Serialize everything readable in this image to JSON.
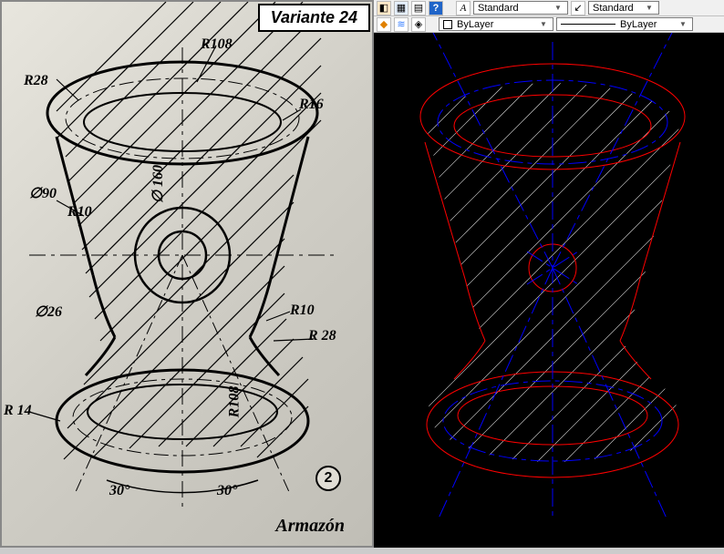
{
  "left": {
    "variant": "Variante 24",
    "footer": "Armazón",
    "badge": "2",
    "dims": {
      "R108_top": "R108",
      "R28_top": "R28",
      "R16": "R16",
      "phi90": "∅90",
      "R10_left": "R10",
      "phi160": "∅ 160",
      "phi26": "∅26",
      "R10_right": "R10",
      "R28_right": "R 28",
      "R14": "R 14",
      "R108_bottom": "R108",
      "ang_left": "30°",
      "ang_right": "30°"
    }
  },
  "toolbar": {
    "combo1": "Standard",
    "combo2": "Standard",
    "combo3": "ByLayer",
    "combo4": "ByLayer"
  },
  "chart_data": {
    "type": "technical-drawing",
    "title": "Armazón — Variante 24",
    "units": "mm (implied)",
    "features": [
      {
        "label": "R108",
        "kind": "radius",
        "value": 108,
        "loc": "top-arc"
      },
      {
        "label": "R108",
        "kind": "radius",
        "value": 108,
        "loc": "bottom-arc"
      },
      {
        "label": "R28",
        "kind": "radius",
        "value": 28,
        "loc": "top-left-torus"
      },
      {
        "label": "R28",
        "kind": "radius",
        "value": 28,
        "loc": "right-neck"
      },
      {
        "label": "R16",
        "kind": "radius",
        "value": 16,
        "loc": "top-right"
      },
      {
        "label": "R14",
        "kind": "radius",
        "value": 14,
        "loc": "bottom-left"
      },
      {
        "label": "R10",
        "kind": "radius",
        "value": 10,
        "loc": "left-neck"
      },
      {
        "label": "R10",
        "kind": "radius",
        "value": 10,
        "loc": "right-neck-upper"
      },
      {
        "label": "∅160",
        "kind": "diameter",
        "value": 160,
        "loc": "upper-body"
      },
      {
        "label": "∅90",
        "kind": "diameter",
        "value": 90,
        "loc": "center-boss"
      },
      {
        "label": "∅26",
        "kind": "diameter",
        "value": 26,
        "loc": "center-hole"
      },
      {
        "label": "30°",
        "kind": "angle",
        "value": 30,
        "loc": "left-taper"
      },
      {
        "label": "30°",
        "kind": "angle",
        "value": 30,
        "loc": "right-taper"
      }
    ]
  }
}
